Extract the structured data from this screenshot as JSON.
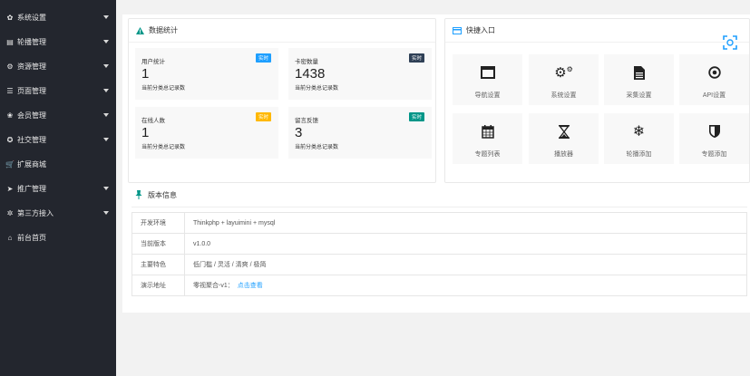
{
  "sidebar": {
    "items": [
      {
        "label": "系统设置",
        "icon": "gear-icon",
        "has_arrow": true
      },
      {
        "label": "轮播管理",
        "icon": "image-icon",
        "has_arrow": true
      },
      {
        "label": "资源管理",
        "icon": "gears-icon",
        "has_arrow": true
      },
      {
        "label": "页面管理",
        "icon": "list-icon",
        "has_arrow": true
      },
      {
        "label": "会员管理",
        "icon": "users-icon",
        "has_arrow": true
      },
      {
        "label": "社交管理",
        "icon": "circle-icon",
        "has_arrow": true
      },
      {
        "label": "扩展商城",
        "icon": "cart-icon",
        "has_arrow": false
      },
      {
        "label": "推广管理",
        "icon": "send-icon",
        "has_arrow": true
      },
      {
        "label": "第三方接入",
        "icon": "cog-icon",
        "has_arrow": true
      },
      {
        "label": "前台首页",
        "icon": "home-icon",
        "has_arrow": false
      }
    ]
  },
  "stats_card": {
    "title": "数据统计",
    "items": [
      {
        "label": "用户统计",
        "badge": "实时",
        "badge_color": "#1e9fff",
        "value": "1",
        "desc": "当前分类总记录数"
      },
      {
        "label": "卡密数量",
        "badge": "实时",
        "badge_color": "#2f4056",
        "value": "1438",
        "desc": "当前分类总记录数"
      },
      {
        "label": "在线人数",
        "badge": "实时",
        "badge_color": "#ffb800",
        "value": "1",
        "desc": "当前分类总记录数"
      },
      {
        "label": "留言反馈",
        "badge": "实时",
        "badge_color": "#009688",
        "value": "3",
        "desc": "当前分类总记录数"
      }
    ]
  },
  "quick_card": {
    "title": "快捷入口",
    "items": [
      {
        "label": "导航设置",
        "icon": "window-icon"
      },
      {
        "label": "系统设置",
        "icon": "cogs-icon"
      },
      {
        "label": "采集设置",
        "icon": "file-icon"
      },
      {
        "label": "API设置",
        "icon": "dot-circle-icon"
      },
      {
        "label": "专题列表",
        "icon": "calendar-icon"
      },
      {
        "label": "播放器",
        "icon": "hourglass-icon"
      },
      {
        "label": "轮播添加",
        "icon": "snowflake-icon"
      },
      {
        "label": "专题添加",
        "icon": "shield-icon"
      }
    ]
  },
  "version_card": {
    "title": "版本信息",
    "rows": [
      {
        "key": "开发环境",
        "value": "Thinkphp + layuimini + mysql",
        "link": ""
      },
      {
        "key": "当前版本",
        "value": "v1.0.0",
        "link": ""
      },
      {
        "key": "主要特色",
        "value": "低门槛 / 灵活 / 清爽 / 极简",
        "link": ""
      },
      {
        "key": "演示地址",
        "value": "零视聚合-v1：",
        "link": "点击查看"
      }
    ]
  },
  "colors": {
    "sidebar_bg": "#23262e",
    "accent": "#1e9fff",
    "green": "#009688"
  }
}
